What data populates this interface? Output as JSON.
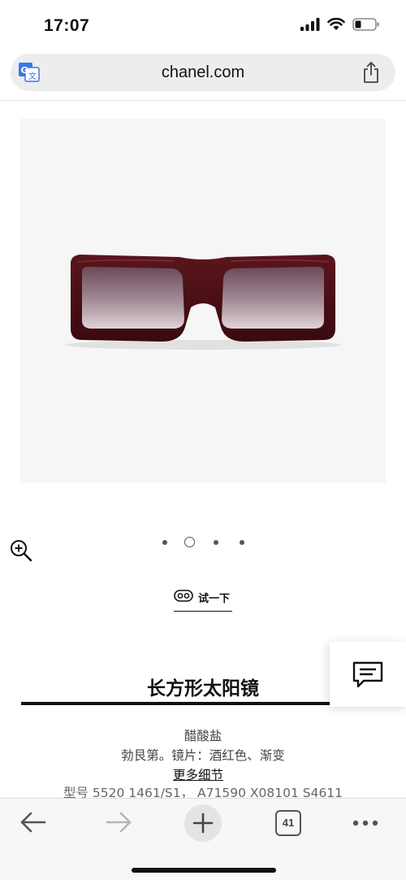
{
  "status_bar": {
    "time": "17:07"
  },
  "browser": {
    "url": "chanel.com",
    "tab_count": "41"
  },
  "product": {
    "try_on_label": "试一下",
    "title": "长方形太阳镜",
    "material": "醋酸盐",
    "color_desc": "勃艮第。镜片：酒红色、渐变",
    "more_details": "更多细节",
    "model_ref": "型号 5520 1461/S1， A71590 X08101 S4611"
  },
  "carousel": {
    "count": 4,
    "active_index": 1
  },
  "colors": {
    "frame": "#4a0f14",
    "lens_top": "#6b4a58",
    "lens_bottom": "#d8cbd0",
    "image_bg": "#f6f6f6"
  },
  "icons": [
    "translate-icon",
    "share-icon",
    "zoom-in-icon",
    "try-on-icon",
    "chat-icon",
    "back-arrow-icon",
    "forward-arrow-icon",
    "plus-icon",
    "tabs-icon",
    "more-icon"
  ]
}
